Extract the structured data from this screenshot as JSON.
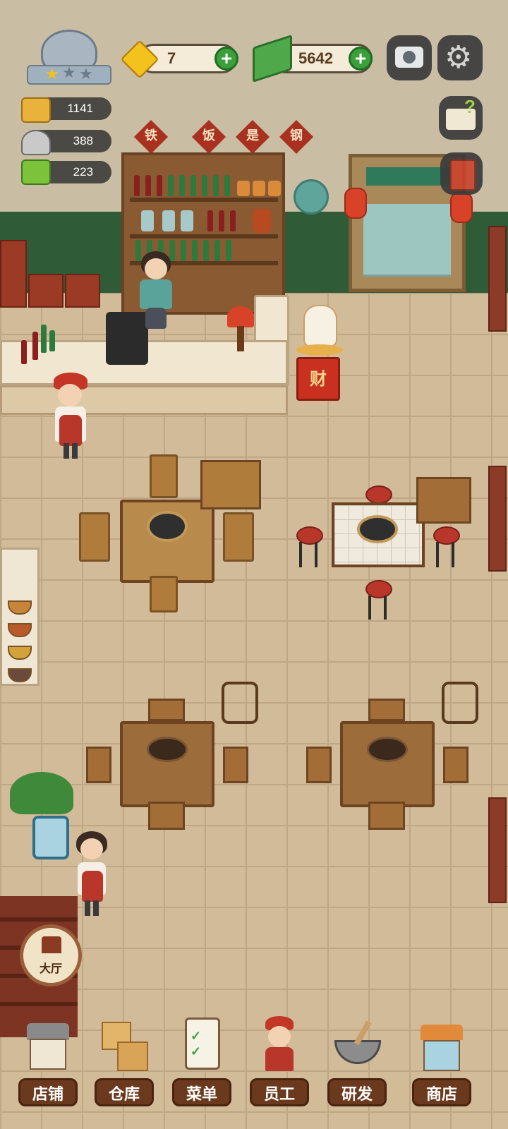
{
  "hud": {
    "gems": "7",
    "cash": "5642",
    "stats": {
      "food": "1141",
      "customers": "388",
      "recipes": "223"
    },
    "rank_stars_filled": 1,
    "rank_stars_total": 3
  },
  "scene": {
    "banner_chars": [
      "铁",
      "饭",
      "是",
      "钢"
    ],
    "fortune_box_char": "财"
  },
  "hall_button": {
    "label": "大厅"
  },
  "nav": [
    {
      "label": "店铺",
      "icon": "shop-building-icon"
    },
    {
      "label": "仓库",
      "icon": "warehouse-boxes-icon"
    },
    {
      "label": "菜单",
      "icon": "menu-clipboard-icon"
    },
    {
      "label": "员工",
      "icon": "staff-chef-icon"
    },
    {
      "label": "研发",
      "icon": "research-wok-icon"
    },
    {
      "label": "商店",
      "icon": "store-front-icon"
    }
  ],
  "colors": {
    "accent_green": "#3ba03a",
    "nav_brown": "#6b3a1e",
    "wall_green": "#2f5b37"
  }
}
